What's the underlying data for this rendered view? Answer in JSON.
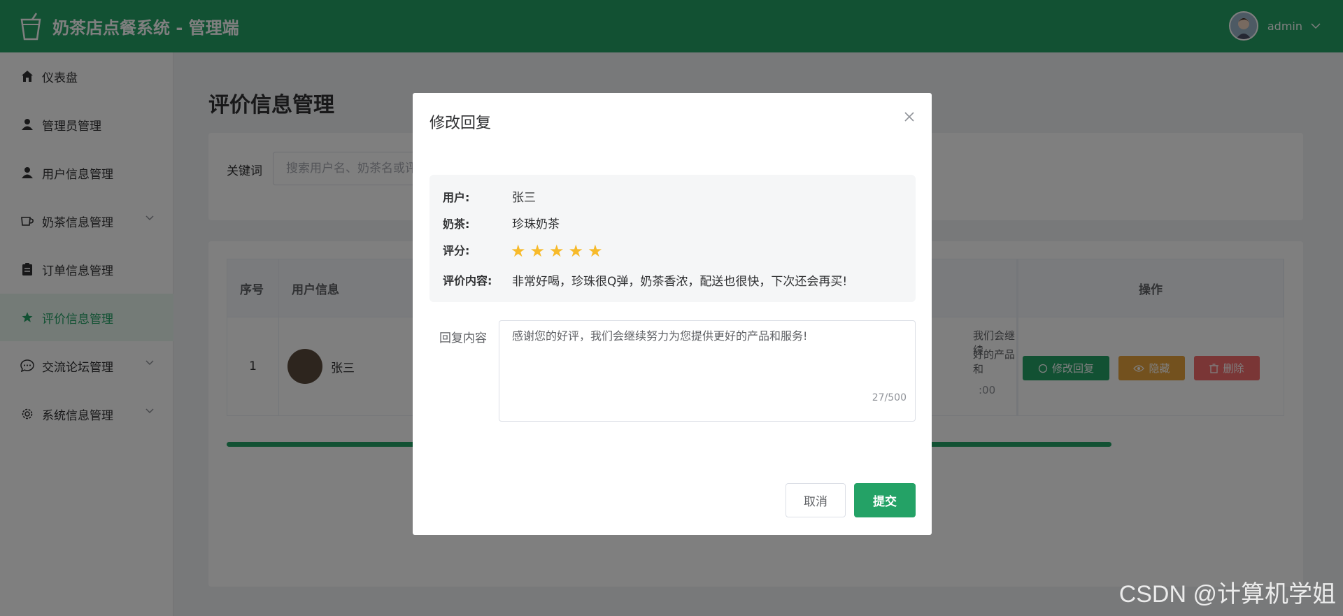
{
  "app": {
    "title": "奶茶店点餐系统 - 管理端",
    "username": "admin"
  },
  "sidebar": {
    "items": [
      {
        "label": "仪表盘",
        "icon": "home-icon"
      },
      {
        "label": "管理员管理",
        "icon": "user-icon"
      },
      {
        "label": "用户信息管理",
        "icon": "user-icon"
      },
      {
        "label": "奶茶信息管理",
        "icon": "cup-icon",
        "expandable": true
      },
      {
        "label": "订单信息管理",
        "icon": "clipboard-icon"
      },
      {
        "label": "评价信息管理",
        "icon": "star-icon",
        "active": true
      },
      {
        "label": "交流论坛管理",
        "icon": "chat-icon",
        "expandable": true
      },
      {
        "label": "系统信息管理",
        "icon": "gear-icon",
        "expandable": true
      }
    ]
  },
  "page": {
    "title": "评价信息管理",
    "search": {
      "label": "关键词",
      "placeholder": "搜索用户名、奶茶名或评"
    },
    "table": {
      "headers": {
        "index": "序号",
        "user": "用户信息",
        "ops": "操作"
      },
      "rows": [
        {
          "index": "1",
          "user": "张三",
          "content_partial": "我们会继续",
          "content_partial2": "好的产品和",
          "time_partial": ":00"
        }
      ],
      "actions": {
        "edit": "修改回复",
        "hide": "隐藏",
        "delete": "删除"
      }
    }
  },
  "dialog": {
    "title": "修改回复",
    "labels": {
      "user": "用户:",
      "tea": "奶茶:",
      "rating": "评分:",
      "content": "评价内容:",
      "reply": "回复内容"
    },
    "values": {
      "user": "张三",
      "tea": "珍珠奶茶",
      "rating": 5,
      "content": "非常好喝，珍珠很Q弹，奶茶香浓，配送也很快，下次还会再买!"
    },
    "reply_text": "感谢您的好评，我们会继续努力为您提供更好的产品和服务!",
    "word_count": "27/500",
    "buttons": {
      "cancel": "取消",
      "submit": "提交"
    }
  },
  "watermark": "CSDN @计算机学姐",
  "colors": {
    "primary": "#24a266",
    "warning": "#e6a23c",
    "danger": "#f56c6c",
    "star": "#f7ba2a"
  }
}
